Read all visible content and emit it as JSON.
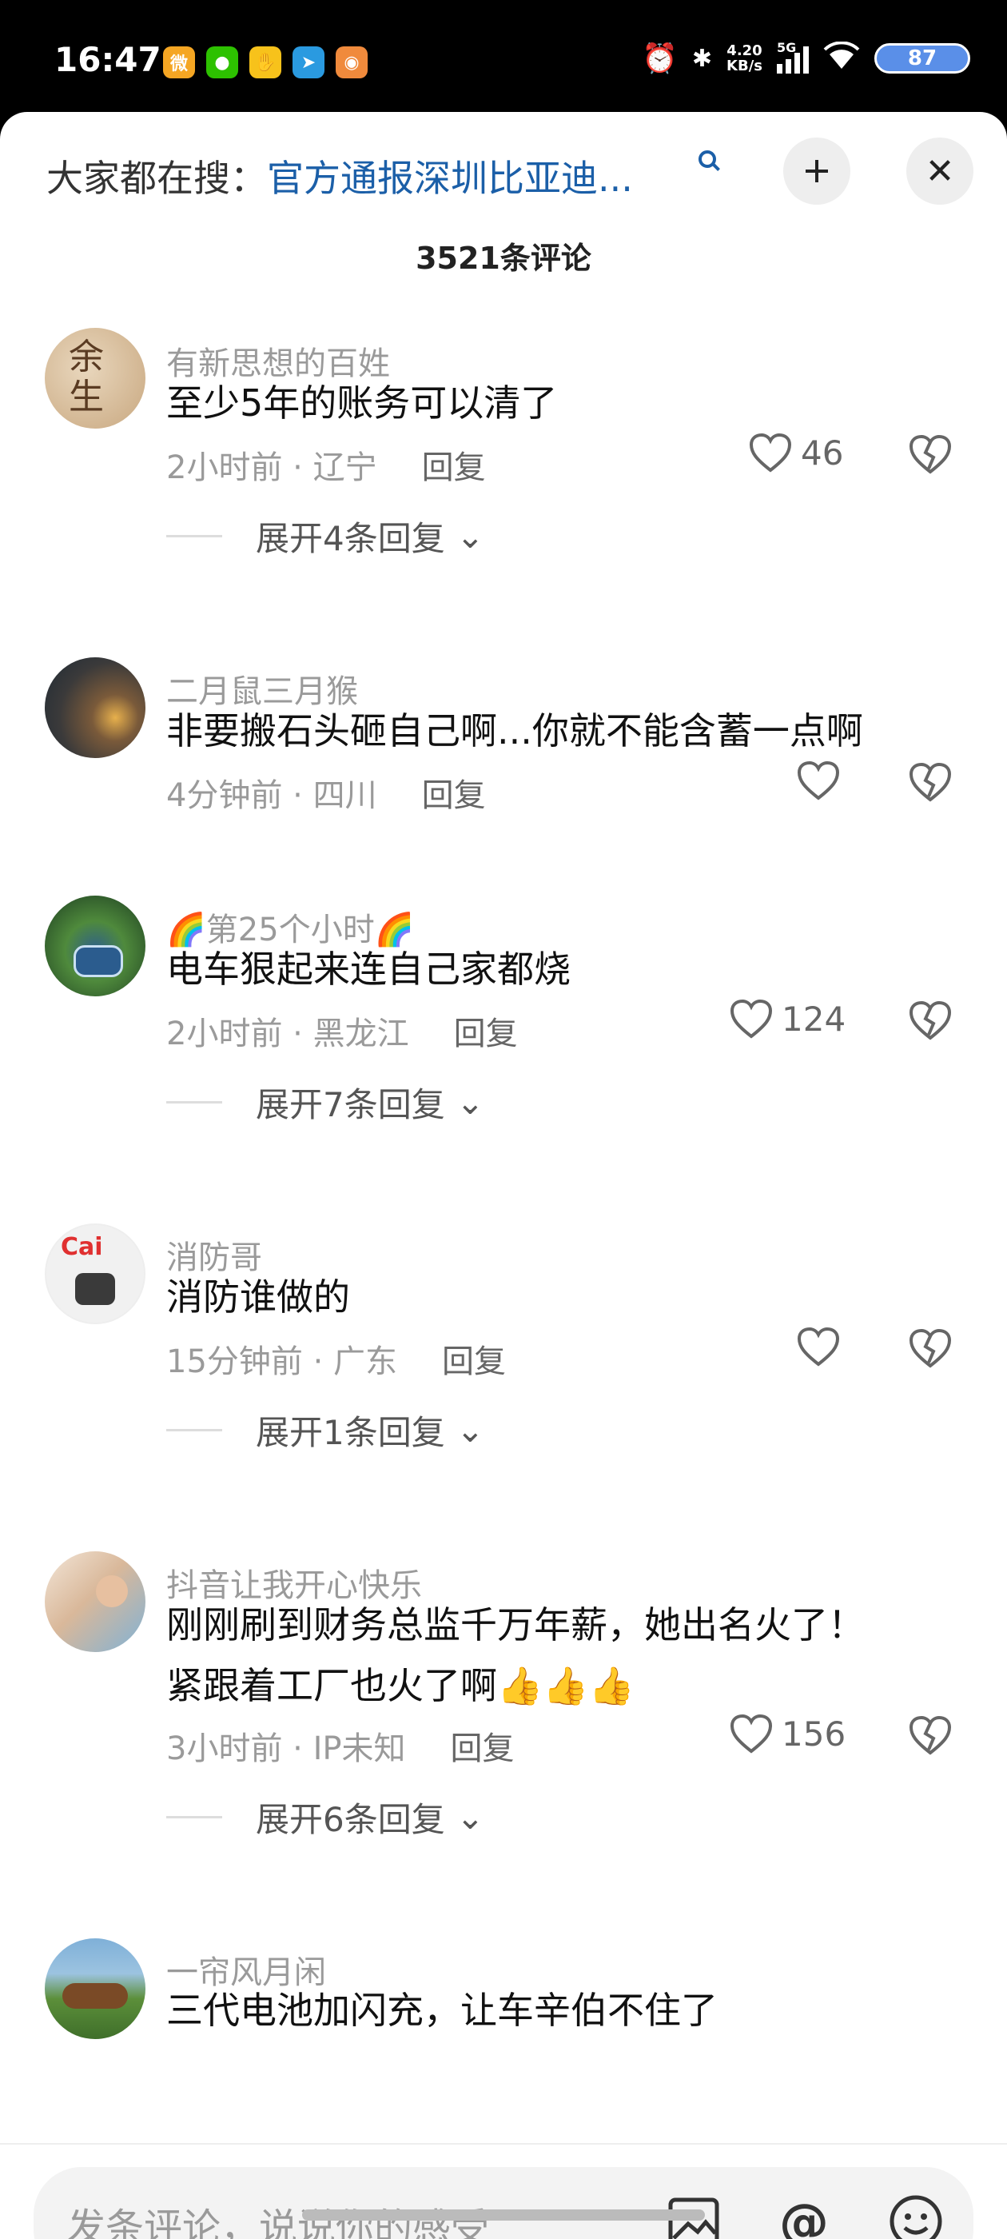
{
  "status_bar": {
    "time": "16:47",
    "net_speed_value": "4.20",
    "net_speed_unit": "KB/s",
    "network": "5G",
    "battery": "87",
    "app_icons": [
      "weibo-icon",
      "wechat-icon",
      "hand-app-icon",
      "telegram-icon",
      "video-app-icon"
    ]
  },
  "header": {
    "search_prefix": "大家都在搜：",
    "search_query": "官方通报深圳比亚迪...",
    "comment_count": "3521条评论"
  },
  "comments": [
    {
      "username": "有新思想的百姓",
      "text": "至少5年的账务可以清了",
      "meta": "2小时前 · 辽宁",
      "reply": "回复",
      "likes": "46",
      "expand": "展开4条回复"
    },
    {
      "username": "二月鼠三月猴",
      "text": "非要搬石头砸自己啊...你就不能含蓄一点啊",
      "meta": "4分钟前 · 四川",
      "reply": "回复",
      "likes": ""
    },
    {
      "username": "🌈第25个小时🌈",
      "text": "电车狠起来连自己家都烧",
      "meta": "2小时前 · 黑龙江",
      "reply": "回复",
      "likes": "124",
      "expand": "展开7条回复"
    },
    {
      "username": "消防哥",
      "text": "消防谁做的",
      "meta": "15分钟前 · 广东",
      "reply": "回复",
      "likes": "",
      "expand": "展开1条回复"
    },
    {
      "username": "抖音让我开心快乐",
      "text_line1": "刚刚刷到财务总监千万年薪，她出名火了！",
      "text_line2": "紧跟着工厂也火了啊👍👍👍",
      "meta": "3小时前 · IP未知",
      "reply": "回复",
      "likes": "156",
      "expand": "展开6条回复"
    },
    {
      "username": "一帘风月闲",
      "text": "三代电池加闪充，让车辛伯不住了"
    }
  ],
  "bottom_bar": {
    "placeholder": "发条评论，说说你的感受"
  },
  "colors": {
    "search_link": "#1b5fa8",
    "username": "#9a9a9a"
  }
}
